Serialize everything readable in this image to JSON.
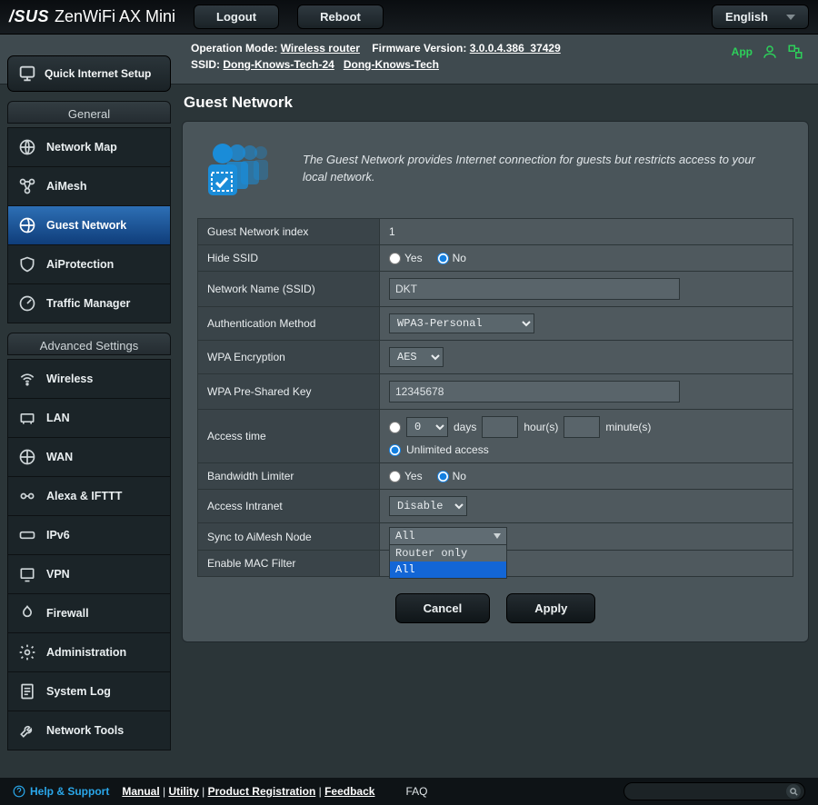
{
  "brand": "/SUS",
  "product": "ZenWiFi AX Mini",
  "topbar": {
    "logout": "Logout",
    "reboot": "Reboot",
    "language": "English"
  },
  "status": {
    "opmode_label": "Operation Mode:",
    "opmode_value": "Wireless router",
    "fw_label": "Firmware Version:",
    "fw_value": "3.0.0.4.386_37429",
    "ssid_label": "SSID:",
    "ssid_values": [
      "Dong-Knows-Tech-24",
      "Dong-Knows-Tech"
    ],
    "app": "App"
  },
  "qis": "Quick Internet Setup",
  "nav": {
    "general_head": "General",
    "general": [
      "Network Map",
      "AiMesh",
      "Guest Network",
      "AiProtection",
      "Traffic Manager"
    ],
    "advanced_head": "Advanced Settings",
    "advanced": [
      "Wireless",
      "LAN",
      "WAN",
      "Alexa & IFTTT",
      "IPv6",
      "VPN",
      "Firewall",
      "Administration",
      "System Log",
      "Network Tools"
    ]
  },
  "page": {
    "title": "Guest Network",
    "desc": "The Guest Network provides Internet connection for guests but restricts access to your local network."
  },
  "form": {
    "index_label": "Guest Network index",
    "index_value": "1",
    "hide_label": "Hide SSID",
    "yes": "Yes",
    "no": "No",
    "ssid_label": "Network Name (SSID)",
    "ssid_value": "DKT",
    "auth_label": "Authentication Method",
    "auth_value": "WPA3-Personal",
    "enc_label": "WPA Encryption",
    "enc_value": "AES",
    "psk_label": "WPA Pre-Shared Key",
    "psk_value": "12345678",
    "access_label": "Access time",
    "days": "days",
    "hours": "hour(s)",
    "minutes": "minute(s)",
    "days_value": "0",
    "hours_value": "",
    "minutes_value": "",
    "unlimited": "Unlimited access",
    "bw_label": "Bandwidth Limiter",
    "intranet_label": "Access Intranet",
    "intranet_value": "Disable",
    "sync_label": "Sync to AiMesh Node",
    "sync_selected": "All",
    "sync_options": [
      "Router only",
      "All"
    ],
    "mac_label": "Enable MAC Filter",
    "cancel": "Cancel",
    "apply": "Apply"
  },
  "footer": {
    "help": "Help & Support",
    "links": [
      "Manual",
      "Utility",
      "Product Registration",
      "Feedback"
    ],
    "faq": "FAQ"
  }
}
